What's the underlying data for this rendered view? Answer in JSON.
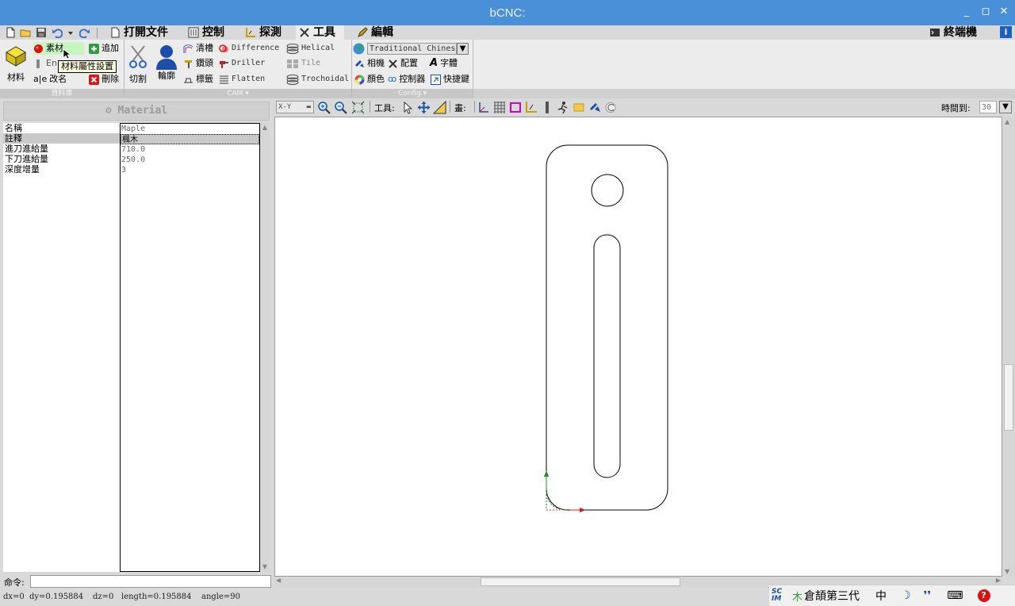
{
  "window": {
    "title": "bCNC:"
  },
  "tabs": [
    {
      "label": "打開文件"
    },
    {
      "label": "控制"
    },
    {
      "label": "探測"
    },
    {
      "label": "工具"
    },
    {
      "label": "編輯"
    }
  ],
  "terminal_label": "終端機",
  "ribbon": {
    "stock": {
      "big_label": "材料",
      "material": "素材",
      "add": "追加",
      "endmill": "En",
      "rename": "改名",
      "delete": "刪除",
      "group_label": "資料庫"
    },
    "cam": {
      "cut": "切割",
      "profile": "輪廓",
      "pocket": "清槽",
      "drill": "鑽頭",
      "tab": "標籤",
      "difference": "Difference",
      "driller": "Driller",
      "flatten": "Flatten",
      "helical": "Helical",
      "tile": "Tile",
      "trochoidal": "Trochoidal",
      "group_label": "CAM"
    },
    "config": {
      "language": "Traditional Chinese",
      "camera": "相機",
      "config": "配置",
      "font": "字體",
      "color": "顏色",
      "controller": "控制器",
      "shortcuts": "快捷鍵",
      "group_label": "Config"
    }
  },
  "tooltip": "材料屬性設置",
  "material_panel": {
    "header": "Material",
    "rows": [
      {
        "name": "名稱",
        "value": "Maple"
      },
      {
        "name": "註釋",
        "value": "楓木"
      },
      {
        "name": "進刀進給量",
        "value": "710.0"
      },
      {
        "name": "下刀進給量",
        "value": "250.0"
      },
      {
        "name": "深度增量",
        "value": "3"
      }
    ]
  },
  "command": {
    "label": "命令:",
    "value": ""
  },
  "viewbar": {
    "view": "X-Y",
    "tools_label": "工具:",
    "draw_label": "畫:",
    "time_label": "時間到:",
    "time_value": "30"
  },
  "status": {
    "dx": "dx=0",
    "dy": "dy=0.195884",
    "dz": "dz=0",
    "length": "length=0.195884",
    "angle": "angle=90"
  },
  "ime": {
    "name": "倉頡第三代",
    "mode": "中"
  },
  "colors": {
    "titlebar": "#4a90d9",
    "x_axis": "#cc2222",
    "y_axis": "#228822",
    "path": "#000000"
  }
}
